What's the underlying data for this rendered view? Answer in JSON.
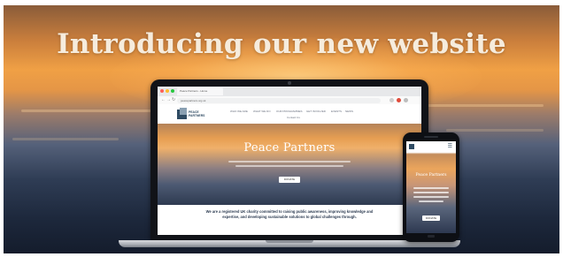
{
  "banner": {
    "headline": "Introducing our new website"
  },
  "laptop": {
    "browser": {
      "tab_title": "Peace Partners - Home",
      "url": "peacepartners.org.uk"
    },
    "site": {
      "logo_text_line1": "PEACE",
      "logo_text_line2": "PARTNERS",
      "nav_items": [
        "WHO WE ARE",
        "WHAT WE DO",
        "OUR PROGRAMMES",
        "GET INVOLVED",
        "EVENTS",
        "NEWS"
      ],
      "nav_contact": "Contact Us",
      "hero_title": "Peace Partners",
      "hero_button": "DONATE",
      "mission_text": "We are a registered UK charity committed to raising public awareness, improving knowledge and expertise, and developing sustainable solutions to global challenges through."
    }
  },
  "phone": {
    "hero_title": "Peace Partners",
    "hero_button": "DONATE"
  },
  "colors": {
    "brand_navy": "#2f4b63",
    "sunset_orange": "#f0a045",
    "sea_blue": "#2f3d55",
    "headline_text": "#f6ecdd"
  }
}
